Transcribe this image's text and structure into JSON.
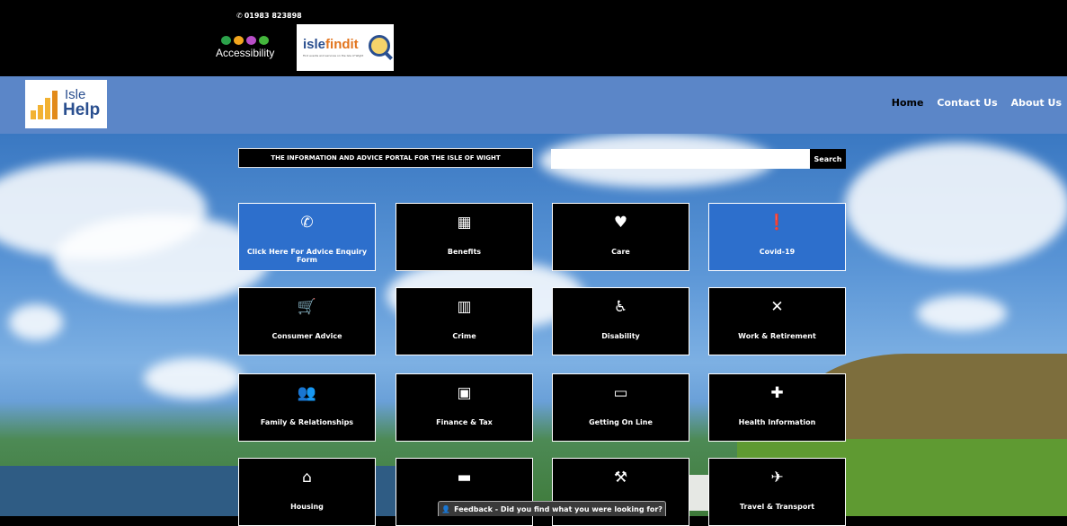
{
  "topbar": {
    "phone": "01983 823898",
    "accessibility_label": "Accessibility",
    "isf_brand_a": "isle",
    "isf_brand_b": "findit",
    "isf_tagline": "Find events and services on the Isle of Wight"
  },
  "logo": {
    "isle": "Isle",
    "help": "Help"
  },
  "nav": {
    "home": "Home",
    "contact": "Contact Us",
    "about": "About Us"
  },
  "hero": {
    "tagline": "THE INFORMATION AND ADVICE PORTAL FOR THE ISLE OF WIGHT",
    "search_placeholder": "",
    "search_button": "Search"
  },
  "tiles": [
    {
      "label": "Click Here For Advice Enquiry Form",
      "icon": "phone-icon",
      "glyph": "✆",
      "blue": true
    },
    {
      "label": "Benefits",
      "icon": "calculator-icon",
      "glyph": "▦",
      "blue": false
    },
    {
      "label": "Care",
      "icon": "heart-icon",
      "glyph": "♥",
      "blue": false
    },
    {
      "label": "Covid-19",
      "icon": "alert-icon",
      "glyph": "❗",
      "blue": true
    },
    {
      "label": "Consumer Advice",
      "icon": "cart-icon",
      "glyph": "🛒",
      "blue": false
    },
    {
      "label": "Crime",
      "icon": "barcode-icon",
      "glyph": "▥",
      "blue": false
    },
    {
      "label": "Disability",
      "icon": "wheelchair-icon",
      "glyph": "♿",
      "blue": false
    },
    {
      "label": "Work & Retirement",
      "icon": "tools-icon",
      "glyph": "✕",
      "blue": false
    },
    {
      "label": "Family & Relationships",
      "icon": "people-icon",
      "glyph": "👥",
      "blue": false
    },
    {
      "label": "Finance & Tax",
      "icon": "money-icon",
      "glyph": "▣",
      "blue": false
    },
    {
      "label": "Getting On Line",
      "icon": "monitor-icon",
      "glyph": "▭",
      "blue": false
    },
    {
      "label": "Health Information",
      "icon": "medical-icon",
      "glyph": "✚",
      "blue": false
    },
    {
      "label": "Housing",
      "icon": "home-icon",
      "glyph": "⌂",
      "blue": false
    },
    {
      "label": "",
      "icon": "briefcase-icon",
      "glyph": "▬",
      "blue": false
    },
    {
      "label": "",
      "icon": "gavel-icon",
      "glyph": "⚒",
      "blue": false
    },
    {
      "label": "Travel & Transport",
      "icon": "plane-icon",
      "glyph": "✈",
      "blue": false
    }
  ],
  "feedback": {
    "label": "Feedback - Did you find what you were looking for?",
    "icon": "user-icon"
  },
  "colors": {
    "nav_blue": "#5b86c8",
    "tile_blue": "#2d6fcc",
    "tile_black": "#000000"
  }
}
